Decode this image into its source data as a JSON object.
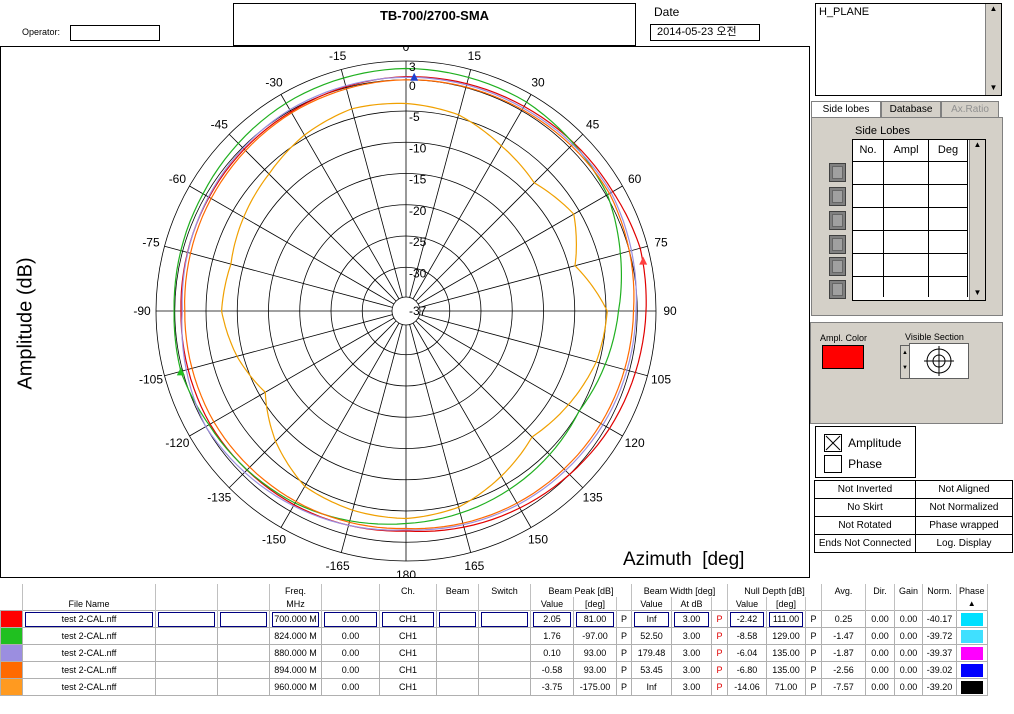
{
  "header": {
    "title": "TB-700/2700-SMA",
    "operator_label": "Operator:",
    "operator_value": "",
    "date_label": "Date",
    "date_value": "2014-05-23 오전"
  },
  "plot": {
    "y_axis_label": "Amplitude  (dB)",
    "x_axis_label": "Azimuth  [deg]",
    "radial_labels": [
      "3",
      "0",
      "-5",
      "-10",
      "-15",
      "-20",
      "-25",
      "-30",
      "-37"
    ],
    "angle_labels": [
      {
        "deg": 0,
        "text": "0"
      },
      {
        "deg": 15,
        "text": "15"
      },
      {
        "deg": 30,
        "text": "30"
      },
      {
        "deg": 45,
        "text": "45"
      },
      {
        "deg": 60,
        "text": "60"
      },
      {
        "deg": 75,
        "text": "75"
      },
      {
        "deg": 90,
        "text": "90"
      },
      {
        "deg": 105,
        "text": "105"
      },
      {
        "deg": 120,
        "text": "120"
      },
      {
        "deg": 135,
        "text": "135"
      },
      {
        "deg": 150,
        "text": "150"
      },
      {
        "deg": 165,
        "text": "165"
      },
      {
        "deg": 180,
        "text": "180"
      },
      {
        "deg": -165,
        "text": "-165"
      },
      {
        "deg": -150,
        "text": "-150"
      },
      {
        "deg": -135,
        "text": "-135"
      },
      {
        "deg": -120,
        "text": "-120"
      },
      {
        "deg": -105,
        "text": "-105"
      },
      {
        "deg": -90,
        "text": "-90"
      },
      {
        "deg": -75,
        "text": "-75"
      },
      {
        "deg": -60,
        "text": "-60"
      },
      {
        "deg": -45,
        "text": "-45"
      },
      {
        "deg": -30,
        "text": "-30"
      },
      {
        "deg": -15,
        "text": "-15"
      }
    ]
  },
  "chart_data": {
    "type": "line",
    "subtype": "polar",
    "title": "TB-700/2700-SMA",
    "xlabel": "Azimuth  [deg]",
    "ylabel": "Amplitude  (dB)",
    "r_range": [
      -37,
      3
    ],
    "r_ticks": [
      3,
      0,
      -5,
      -10,
      -15,
      -20,
      -25,
      -30,
      -37
    ],
    "theta_ticks": [
      0,
      15,
      30,
      45,
      60,
      75,
      90,
      105,
      120,
      135,
      150,
      165,
      180,
      -165,
      -150,
      -135,
      -120,
      -105,
      -90,
      -75,
      -60,
      -45,
      -30,
      -15
    ],
    "grid": true,
    "series": [
      {
        "color": "#e00000",
        "points": [
          [
            -180,
            -1.8
          ],
          [
            -150,
            -1.2
          ],
          [
            -120,
            -0.8
          ],
          [
            -90,
            -1.0
          ],
          [
            -60,
            -0.6
          ],
          [
            -30,
            -0.2
          ],
          [
            0,
            0.5
          ],
          [
            30,
            0.8
          ],
          [
            60,
            1.2
          ],
          [
            75,
            1.8
          ],
          [
            90,
            1.4
          ],
          [
            120,
            0.6
          ],
          [
            150,
            -0.6
          ],
          [
            180,
            -1.8
          ]
        ]
      },
      {
        "color": "#20b020",
        "points": [
          [
            -180,
            -3.0
          ],
          [
            -150,
            -1.5
          ],
          [
            -120,
            -0.6
          ],
          [
            -105,
            0.3
          ],
          [
            -90,
            0.1
          ],
          [
            -60,
            0.5
          ],
          [
            -30,
            1.4
          ],
          [
            0,
            1.8
          ],
          [
            30,
            1.6
          ],
          [
            60,
            0.2
          ],
          [
            75,
            -1.5
          ],
          [
            90,
            -3.0
          ],
          [
            120,
            -5.0
          ],
          [
            150,
            -4.0
          ],
          [
            180,
            -3.0
          ]
        ]
      },
      {
        "color": "#9b8ee0",
        "points": [
          [
            -180,
            -2.0
          ],
          [
            -150,
            -1.0
          ],
          [
            -120,
            0.0
          ],
          [
            -90,
            -1.2
          ],
          [
            -60,
            -0.5
          ],
          [
            -30,
            0.2
          ],
          [
            0,
            0.4
          ],
          [
            30,
            0.5
          ],
          [
            60,
            0.9
          ],
          [
            90,
            -0.2
          ],
          [
            120,
            -0.6
          ],
          [
            150,
            -1.2
          ],
          [
            180,
            -2.0
          ]
        ]
      },
      {
        "color": "#ff6a00",
        "points": [
          [
            -180,
            -2.2
          ],
          [
            -150,
            -1.8
          ],
          [
            -120,
            -1.5
          ],
          [
            -90,
            -1.6
          ],
          [
            -60,
            -1.0
          ],
          [
            -30,
            -0.4
          ],
          [
            0,
            0.0
          ],
          [
            30,
            0.2
          ],
          [
            60,
            0.6
          ],
          [
            90,
            -0.6
          ],
          [
            120,
            -1.0
          ],
          [
            150,
            -1.5
          ],
          [
            180,
            -2.2
          ]
        ]
      },
      {
        "color": "#f0a000",
        "points": [
          [
            -180,
            -3.8
          ],
          [
            -165,
            -4.0
          ],
          [
            -150,
            -4.6
          ],
          [
            -135,
            -7.5
          ],
          [
            -120,
            -11.0
          ],
          [
            -105,
            -9.0
          ],
          [
            -90,
            -7.5
          ],
          [
            -75,
            -8.0
          ],
          [
            -60,
            -7.0
          ],
          [
            -45,
            -6.0
          ],
          [
            -30,
            -4.5
          ],
          [
            -15,
            -3.5
          ],
          [
            0,
            -3.8
          ],
          [
            15,
            -4.5
          ],
          [
            30,
            -6.5
          ],
          [
            45,
            -8.0
          ],
          [
            60,
            -6.0
          ],
          [
            75,
            -9.0
          ],
          [
            90,
            -4.8
          ],
          [
            105,
            -5.5
          ],
          [
            120,
            -7.0
          ],
          [
            135,
            -8.5
          ],
          [
            150,
            -6.5
          ],
          [
            165,
            -4.5
          ],
          [
            180,
            -3.8
          ]
        ]
      }
    ],
    "markers": [
      {
        "deg": 2,
        "r": 0.5,
        "color": "#2040d0"
      },
      {
        "deg": 78,
        "r": 1.8,
        "color": "#ff4040"
      },
      {
        "deg": -105,
        "r": 0.3,
        "color": "#20c020"
      }
    ]
  },
  "panel": {
    "list_title": "H_PLANE",
    "tabs": [
      "Side lobes",
      "Database",
      "Ax.Ratio"
    ],
    "side_lobes_title": "Side Lobes",
    "side_lobes_headers": [
      "No.",
      "Ampl",
      "Deg"
    ],
    "ampl_color_label": "Ampl. Color",
    "ampl_color": "#ff0000",
    "visible_section_label": "Visible Section",
    "checkboxes": [
      {
        "label": "Amplitude",
        "checked": true
      },
      {
        "label": "Phase",
        "checked": false
      }
    ],
    "flags": [
      [
        "Not Inverted",
        "Not Aligned"
      ],
      [
        "No Skirt",
        "Not Normalized"
      ],
      [
        "Not Rotated",
        "Phase wrapped"
      ],
      [
        "Ends Not Connected",
        "Log. Display"
      ]
    ]
  },
  "table": {
    "headers_top": [
      "",
      "",
      "",
      "",
      "Freq.",
      "",
      "Ch.",
      "Beam",
      "Switch",
      "Beam Peak [dB]",
      "Beam Width [deg]",
      "Null Depth [dB]",
      "Avg.",
      "Dir.",
      "Gain",
      "Norm.",
      "Phase"
    ],
    "headers_bottom": [
      "",
      "File Name",
      "MHz",
      "Value",
      "[deg]",
      "Value",
      "At dB",
      "Value",
      "[deg]"
    ],
    "rows": [
      {
        "color": "#ff0000",
        "file": "test 2-CAL.nff",
        "c1": "",
        "c2": "",
        "freq": "700.000 M",
        "val": "0.00",
        "ch": "CH1",
        "beam": "",
        "switch": "",
        "bp_val": "2.05",
        "bp_deg": "81.00",
        "bp_p": "P",
        "bw_val": "Inf",
        "bw_at": "3.00",
        "bw_p": "P",
        "nd_val": "-2.42",
        "nd_deg": "111.00",
        "nd_p": "P",
        "avg": "0.25",
        "dir": "0.00",
        "gain": "0.00",
        "norm": "-40.17",
        "phase_color": "#00e0ff"
      },
      {
        "color": "#20c020",
        "file": "test 2-CAL.nff",
        "c1": "",
        "c2": "",
        "freq": "824.000 M",
        "val": "0.00",
        "ch": "CH1",
        "beam": "",
        "switch": "",
        "bp_val": "1.76",
        "bp_deg": "-97.00",
        "bp_p": "P",
        "bw_val": "52.50",
        "bw_at": "3.00",
        "bw_p": "P",
        "nd_val": "-8.58",
        "nd_deg": "129.00",
        "nd_p": "P",
        "avg": "-1.47",
        "dir": "0.00",
        "gain": "0.00",
        "norm": "-39.72",
        "phase_color": "#40e0ff"
      },
      {
        "color": "#9b8ee0",
        "file": "test 2-CAL.nff",
        "c1": "",
        "c2": "",
        "freq": "880.000 M",
        "val": "0.00",
        "ch": "CH1",
        "beam": "",
        "switch": "",
        "bp_val": "0.10",
        "bp_deg": "93.00",
        "bp_p": "P",
        "bw_val": "179.48",
        "bw_at": "3.00",
        "bw_p": "P",
        "nd_val": "-6.04",
        "nd_deg": "135.00",
        "nd_p": "P",
        "avg": "-1.87",
        "dir": "0.00",
        "gain": "0.00",
        "norm": "-39.37",
        "phase_color": "#ff00ff"
      },
      {
        "color": "#ff6a00",
        "file": "test 2-CAL.nff",
        "c1": "",
        "c2": "",
        "freq": "894.000 M",
        "val": "0.00",
        "ch": "CH1",
        "beam": "",
        "switch": "",
        "bp_val": "-0.58",
        "bp_deg": "93.00",
        "bp_p": "P",
        "bw_val": "53.45",
        "bw_at": "3.00",
        "bw_p": "P",
        "nd_val": "-6.80",
        "nd_deg": "135.00",
        "nd_p": "P",
        "avg": "-2.56",
        "dir": "0.00",
        "gain": "0.00",
        "norm": "-39.02",
        "phase_color": "#0000ff"
      },
      {
        "color": "#ff9a20",
        "file": "test 2-CAL.nff",
        "c1": "",
        "c2": "",
        "freq": "960.000 M",
        "val": "0.00",
        "ch": "CH1",
        "beam": "",
        "switch": "",
        "bp_val": "-3.75",
        "bp_deg": "-175.00",
        "bp_p": "P",
        "bw_val": "Inf",
        "bw_at": "3.00",
        "bw_p": "P",
        "nd_val": "-14.06",
        "nd_deg": "71.00",
        "nd_p": "P",
        "avg": "-7.57",
        "dir": "0.00",
        "gain": "0.00",
        "norm": "-39.20",
        "phase_color": "#000000"
      }
    ]
  }
}
